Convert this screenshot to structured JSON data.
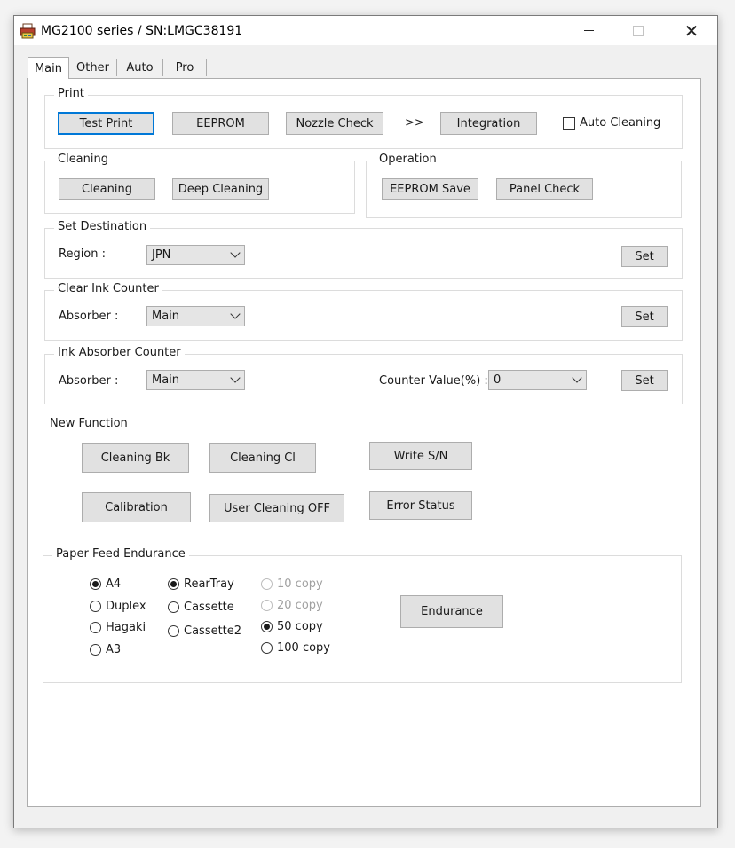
{
  "window": {
    "title": "MG2100 series / SN:LMGC38191",
    "minimize_glyph": "—",
    "close_glyph": "✕",
    "app_icon": "printer-app-icon"
  },
  "tabs": [
    {
      "label": "Main",
      "active": true
    },
    {
      "label": "Other",
      "active": false
    },
    {
      "label": "Auto",
      "active": false
    },
    {
      "label": "Pro",
      "active": false
    }
  ],
  "print_group": {
    "legend": "Print",
    "test_print": "Test Print",
    "eeprom": "EEPROM",
    "nozzle_check": "Nozzle Check",
    "arrow": ">>",
    "integration": "Integration",
    "auto_cleaning": "Auto Cleaning",
    "auto_cleaning_checked": false
  },
  "cleaning_group": {
    "legend": "Cleaning",
    "cleaning": "Cleaning",
    "deep_cleaning": "Deep Cleaning"
  },
  "operation_group": {
    "legend": "Operation",
    "eeprom_save": "EEPROM Save",
    "panel_check": "Panel Check"
  },
  "set_destination": {
    "legend": "Set Destination",
    "region_label": "Region :",
    "region_value": "JPN",
    "set": "Set"
  },
  "clear_ink_counter": {
    "legend": "Clear Ink Counter",
    "absorber_label": "Absorber :",
    "absorber_value": "Main",
    "set": "Set"
  },
  "ink_absorber_counter": {
    "legend": "Ink Absorber Counter",
    "absorber_label": "Absorber :",
    "absorber_value": "Main",
    "counter_label": "Counter Value(%) :",
    "counter_value": "0",
    "set": "Set"
  },
  "new_function": {
    "heading": "New Function",
    "cleaning_bk": "Cleaning Bk",
    "cleaning_cl": "Cleaning Cl",
    "write_sn": "Write S/N",
    "calibration": "Calibration",
    "user_cleaning_off": "User Cleaning OFF",
    "error_status": "Error Status"
  },
  "paper_feed": {
    "legend": "Paper Feed Endurance",
    "paper_sizes": [
      "A4",
      "Duplex",
      "Hagaki",
      "A3"
    ],
    "paper_size_selected": "A4",
    "sources": [
      "RearTray",
      "Cassette",
      "Cassette2"
    ],
    "source_selected": "RearTray",
    "copies": [
      {
        "label": "10 copy",
        "enabled": false,
        "selected": false
      },
      {
        "label": "20 copy",
        "enabled": false,
        "selected": false
      },
      {
        "label": "50 copy",
        "enabled": true,
        "selected": true
      },
      {
        "label": "100 copy",
        "enabled": true,
        "selected": false
      }
    ],
    "endurance": "Endurance"
  }
}
